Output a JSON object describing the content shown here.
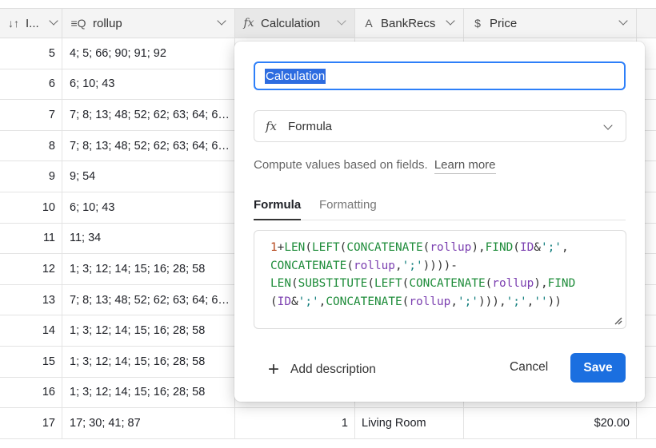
{
  "header": {
    "id_label": "I...",
    "rollup_label": "rollup",
    "calc_label": "Calculation",
    "bank_label": "BankRecs",
    "price_label": "Price",
    "id_icon": "↓↑",
    "rollup_icon": "≡Q",
    "calc_icon": "fx",
    "bank_icon": "A",
    "price_icon": "$"
  },
  "rows": [
    {
      "id": "5",
      "rollup": "4; 5; 66; 90; 91; 92",
      "calc": "",
      "bank": "",
      "price": ""
    },
    {
      "id": "6",
      "rollup": "6; 10; 43",
      "calc": "",
      "bank": "",
      "price": ""
    },
    {
      "id": "7",
      "rollup": "7; 8; 13; 48; 52; 62; 63; 64; 6…",
      "calc": "",
      "bank": "",
      "price": ""
    },
    {
      "id": "8",
      "rollup": "7; 8; 13; 48; 52; 62; 63; 64; 6…",
      "calc": "",
      "bank": "",
      "price": ""
    },
    {
      "id": "9",
      "rollup": "9; 54",
      "calc": "",
      "bank": "",
      "price": ""
    },
    {
      "id": "10",
      "rollup": "6; 10; 43",
      "calc": "",
      "bank": "",
      "price": ""
    },
    {
      "id": "11",
      "rollup": "11; 34",
      "calc": "",
      "bank": "",
      "price": ""
    },
    {
      "id": "12",
      "rollup": "1; 3; 12; 14; 15; 16; 28; 58",
      "calc": "",
      "bank": "",
      "price": ""
    },
    {
      "id": "13",
      "rollup": "7; 8; 13; 48; 52; 62; 63; 64; 6…",
      "calc": "",
      "bank": "",
      "price": ""
    },
    {
      "id": "14",
      "rollup": "1; 3; 12; 14; 15; 16; 28; 58",
      "calc": "",
      "bank": "",
      "price": ""
    },
    {
      "id": "15",
      "rollup": "1; 3; 12; 14; 15; 16; 28; 58",
      "calc": "",
      "bank": "",
      "price": ""
    },
    {
      "id": "16",
      "rollup": "1; 3; 12; 14; 15; 16; 28; 58",
      "calc": "",
      "bank": "",
      "price": ""
    },
    {
      "id": "17",
      "rollup": "17; 30; 41; 87",
      "calc": "1",
      "bank": "Living Room",
      "price": "$20.00"
    }
  ],
  "popover": {
    "field_name": "Calculation",
    "type_icon": "fx",
    "type_label": "Formula",
    "description": "Compute values based on fields.",
    "learn_more": "Learn more",
    "tab_formula": "Formula",
    "tab_formatting": "Formatting",
    "add_description": "Add description",
    "cancel": "Cancel",
    "save": "Save"
  },
  "colors": {
    "accent": "#2d7ff9",
    "save_button": "#1b6fe0",
    "header_bg": "#f4f4f4"
  }
}
